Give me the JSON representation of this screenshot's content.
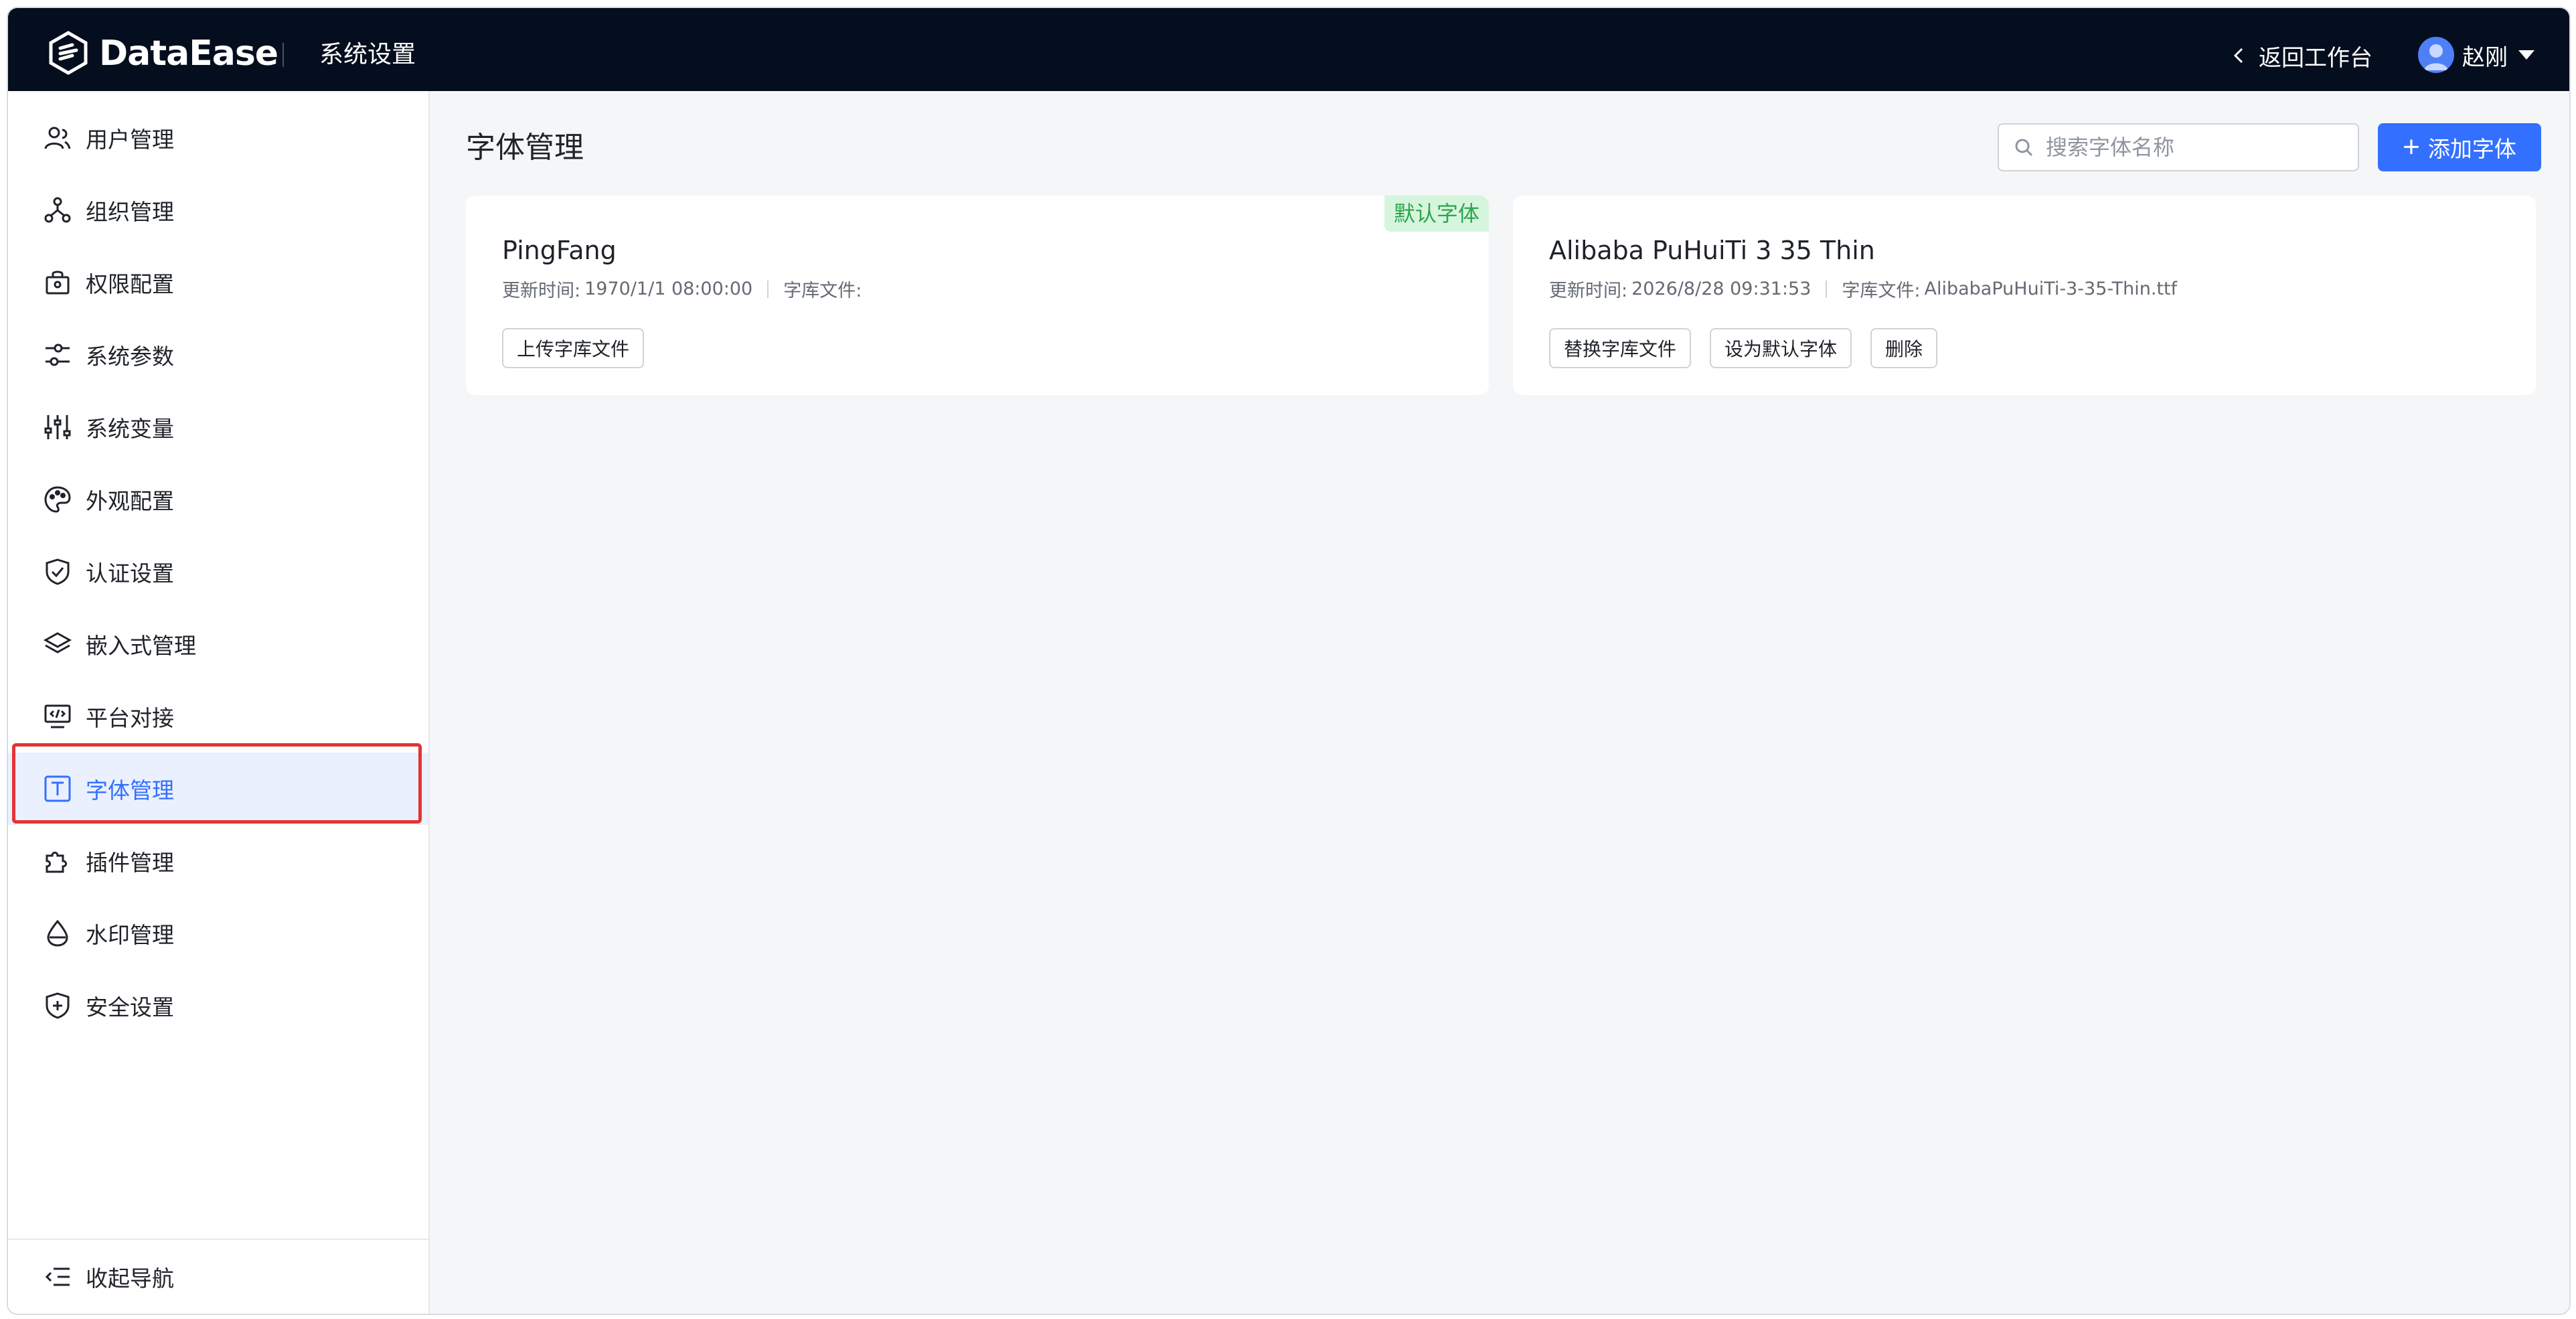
{
  "header": {
    "brand": "DataEase",
    "section_title": "系统设置",
    "back_label": "返回工作台",
    "user_name": "赵刚"
  },
  "sidebar": {
    "items": [
      {
        "label": "用户管理",
        "icon": "users-icon"
      },
      {
        "label": "组织管理",
        "icon": "org-tree-icon"
      },
      {
        "label": "权限配置",
        "icon": "lock-bag-icon"
      },
      {
        "label": "系统参数",
        "icon": "sliders-icon"
      },
      {
        "label": "系统变量",
        "icon": "variables-icon"
      },
      {
        "label": "外观配置",
        "icon": "palette-icon"
      },
      {
        "label": "认证设置",
        "icon": "shield-check-icon"
      },
      {
        "label": "嵌入式管理",
        "icon": "layers-icon"
      },
      {
        "label": "平台对接",
        "icon": "monitor-code-icon"
      },
      {
        "label": "字体管理",
        "icon": "font-icon",
        "active": true
      },
      {
        "label": "插件管理",
        "icon": "puzzle-icon"
      },
      {
        "label": "水印管理",
        "icon": "drop-icon"
      },
      {
        "label": "安全设置",
        "icon": "shield-plus-icon"
      }
    ],
    "collapse_label": "收起导航"
  },
  "main": {
    "title": "字体管理",
    "search_placeholder": "搜索字体名称",
    "add_label": "添加字体",
    "fonts": [
      {
        "name": "PingFang",
        "badge": "默认字体",
        "updated_label": "更新时间:",
        "updated": "1970/1/1 08:00:00",
        "file_label": "字库文件:",
        "file": "",
        "actions": [
          "上传字库文件"
        ]
      },
      {
        "name": "Alibaba PuHuiTi 3 35 Thin",
        "updated_label": "更新时间:",
        "updated": "2026/8/28 09:31:53",
        "file_label": "字库文件:",
        "file": "AlibabaPuHuiTi-3-35-Thin.ttf",
        "actions": [
          "替换字库文件",
          "设为默认字体",
          "删除"
        ]
      }
    ]
  },
  "colors": {
    "header_bg": "#050e1e",
    "accent": "#3370ff",
    "active_bg": "#eaf0fe",
    "badge_bg": "#d6f5dd",
    "badge_text": "#2ea44f",
    "highlight": "#e23434"
  }
}
